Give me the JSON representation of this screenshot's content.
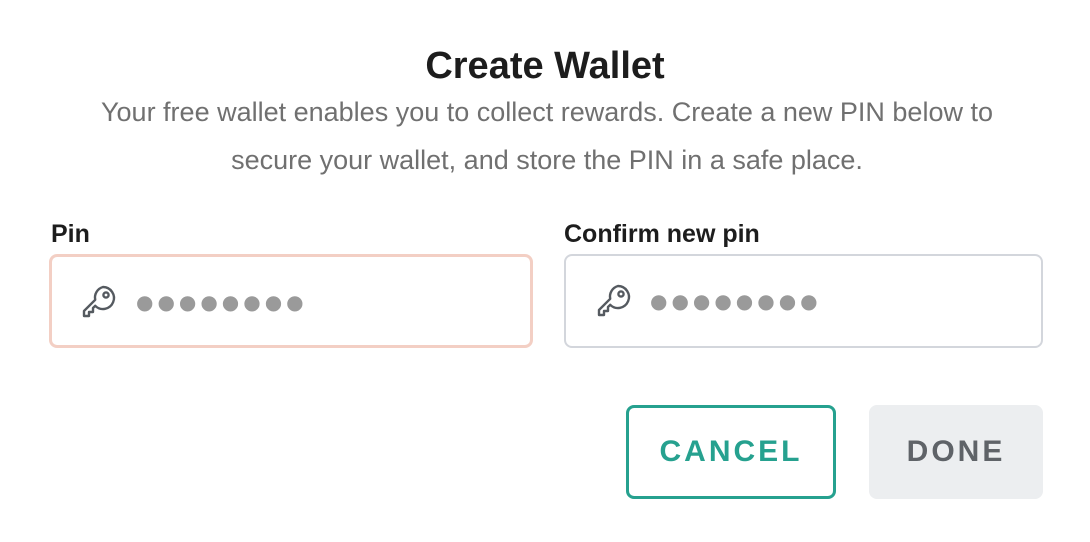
{
  "dialog": {
    "title": "Create Wallet",
    "description": "Your free wallet enables you to collect rewards. Create a new PIN below to secure your wallet, and store the PIN in a safe place."
  },
  "fields": {
    "pin": {
      "label": "Pin",
      "placeholder": "●●●●●●●●",
      "value": "",
      "icon": "key-icon",
      "focused": true
    },
    "confirm_pin": {
      "label": "Confirm new pin",
      "placeholder": "●●●●●●●●",
      "value": "",
      "icon": "key-icon",
      "focused": false
    }
  },
  "actions": {
    "cancel_label": "CANCEL",
    "done_label": "DONE"
  },
  "colors": {
    "accent": "#26a18f",
    "focus_border": "#f3cfc4",
    "field_border": "#d3d6dc",
    "disabled_button_bg": "#eceef0"
  }
}
